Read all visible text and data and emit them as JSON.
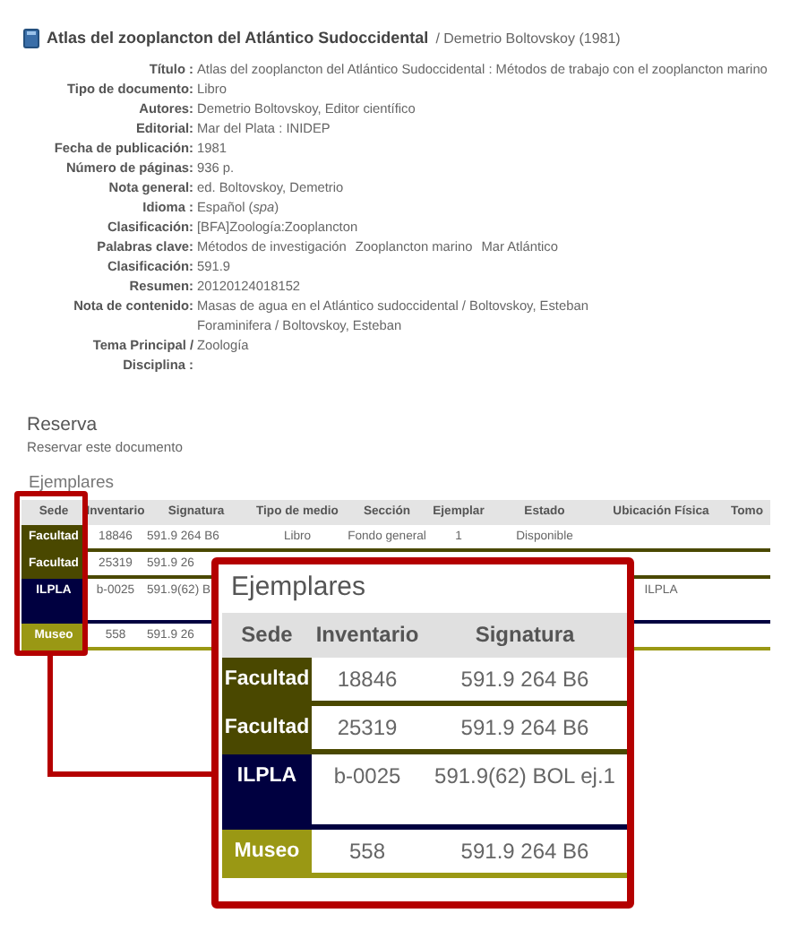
{
  "record": {
    "title": "Atlas del zooplancton del Atlántico Sudoccidental",
    "byline": "/ Demetrio Boltovskoy (1981)"
  },
  "fields": [
    {
      "label": "Título :",
      "value": "Atlas del zooplancton del Atlántico Sudoccidental : Métodos de trabajo con el zooplancton marino"
    },
    {
      "label": "Tipo de documento:",
      "value": "Libro"
    },
    {
      "label": "Autores:",
      "value": "Demetrio Boltovskoy, Editor científico"
    },
    {
      "label": "Editorial:",
      "value": "Mar del Plata : INIDEP"
    },
    {
      "label": "Fecha de publicación:",
      "value": "1981"
    },
    {
      "label": "Número de páginas:",
      "value": "936 p."
    },
    {
      "label": "Nota general:",
      "value": "ed. Boltovskoy, Demetrio"
    },
    {
      "label": "Idioma :",
      "value": "Español (*spa*)"
    },
    {
      "label": "Clasificación:",
      "value": "[BFA]Zoología:Zooplancton"
    },
    {
      "label": "Palabras clave:",
      "keywords": [
        "Métodos de investigación",
        "Zooplancton marino",
        "Mar Atlántico"
      ]
    },
    {
      "label": "Clasificación:",
      "value": "591.9"
    },
    {
      "label": "Resumen:",
      "value": "20120124018152"
    },
    {
      "label": "Nota de contenido:",
      "lines": [
        "Masas de agua en el Atlántico sudoccidental / Boltovskoy, Esteban",
        "Foraminifera / Boltovskoy, Esteban"
      ]
    },
    {
      "label": "Tema Principal /\nDisciplina :",
      "value": "Zoología"
    }
  ],
  "reserva": {
    "heading": "Reserva",
    "link": "Reservar este documento"
  },
  "ejemplares": {
    "heading": "Ejemplares",
    "columns": [
      "Sede",
      "Inventario",
      "Signatura",
      "Tipo de medio",
      "Sección",
      "Ejemplar",
      "Estado",
      "Ubicación Física",
      "Tomo"
    ],
    "rows": [
      {
        "color": "#4a4800",
        "cells": [
          "Facultad",
          "18846",
          "591.9 264 B6",
          "Libro",
          "Fondo general",
          "1",
          "Disponible",
          null,
          null
        ]
      },
      {
        "color": "#4a4800",
        "cells": [
          "Facultad",
          "25319",
          "591.9 26",
          null,
          null,
          null,
          null,
          null,
          null
        ]
      },
      {
        "color": "#000040",
        "cells": [
          "ILPLA",
          "b-0025",
          "591.9(62) B",
          null,
          null,
          null,
          null,
          "ILPLA",
          null
        ]
      },
      {
        "color": "#9a9814",
        "cells": [
          "Museo",
          "558",
          "591.9 26",
          null,
          null,
          null,
          null,
          null,
          null
        ]
      }
    ]
  },
  "zoom_callout": {
    "heading": "Ejemplares",
    "columns": [
      "Sede",
      "Inventario",
      "Signatura"
    ],
    "rows": [
      {
        "color": "#4a4800",
        "cells": [
          "Facultad",
          "18846",
          "591.9 264 B6"
        ]
      },
      {
        "color": "#4a4800",
        "cells": [
          "Facultad",
          "25319",
          "591.9 264 B6"
        ]
      },
      {
        "color": "#000040",
        "cells": [
          "ILPLA",
          "b-0025",
          "591.9(62) BOL ej.1"
        ]
      },
      {
        "color": "#9a9814",
        "cells": [
          "Museo",
          "558",
          "591.9 264 B6"
        ]
      }
    ]
  }
}
